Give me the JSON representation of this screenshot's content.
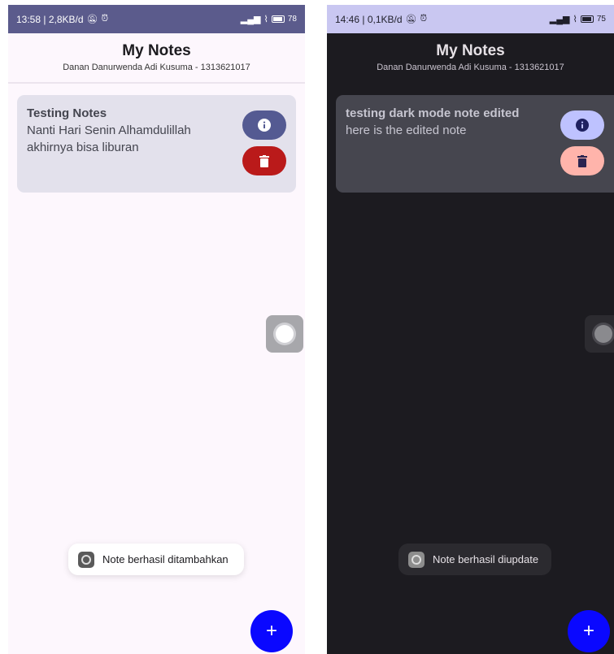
{
  "light": {
    "status": {
      "time_info": "13:58 | 2,8KB/d",
      "battery": "78"
    },
    "header": {
      "title": "My Notes",
      "subtitle": "Danan Danurwenda Adi Kusuma - 1313621017"
    },
    "note": {
      "title": "Testing Notes",
      "body": "Nanti Hari Senin Alhamdulillah akhirnya bisa liburan"
    },
    "toast": {
      "message": "Note berhasil ditambahkan"
    },
    "fab_label": "+"
  },
  "dark": {
    "status": {
      "time_info": "14:46 | 0,1KB/d",
      "battery": "75"
    },
    "header": {
      "title": "My Notes",
      "subtitle": "Danan Danurwenda Adi Kusuma - 1313621017"
    },
    "note": {
      "title": "testing dark mode note edited",
      "body": "here is the edited note"
    },
    "toast": {
      "message": "Note berhasil diupdate"
    },
    "fab_label": "+"
  },
  "icons": {
    "info": "info-icon",
    "delete": "trash-icon",
    "status": [
      "mute-icon",
      "alarm-icon",
      "signal-icon",
      "wifi-icon",
      "battery-icon"
    ]
  },
  "colors": {
    "light_status_bar": "#5b5b8c",
    "dark_status_bar": "#c9c7f1",
    "light_background": "#fdf7fd",
    "dark_background": "#1c1b20",
    "light_info_button": "#545a92",
    "light_delete_button": "#ba1a1a",
    "dark_info_button": "#bec2ff",
    "dark_delete_button": "#ffb4ab",
    "fab": "#0a08ff"
  }
}
